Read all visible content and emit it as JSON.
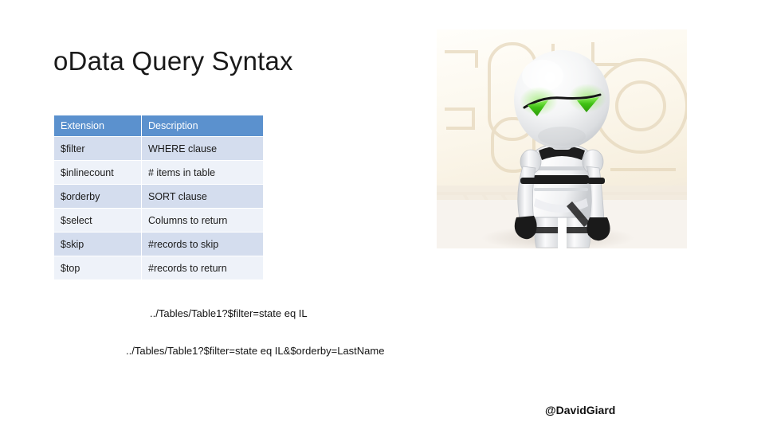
{
  "slide": {
    "title": "oData Query Syntax",
    "footer_handle": "@DavidGiard"
  },
  "table": {
    "name": "odata-query-syntax-table",
    "columns": [
      "Extension",
      "Description"
    ],
    "rows": [
      {
        "extension": "$filter",
        "description": "WHERE clause"
      },
      {
        "extension": "$inlinecount",
        "description": "# items in table"
      },
      {
        "extension": "$orderby",
        "description": "SORT clause"
      },
      {
        "extension": "$select",
        "description": "Columns to return"
      },
      {
        "extension": "$skip",
        "description": "#records to skip"
      },
      {
        "extension": "$top",
        "description": "#records to return"
      }
    ],
    "header_background": "#5B91CE",
    "header_text_color": "#FFFFFF",
    "row_tint_background": "#D4DDEE",
    "row_plain_background": "#EEF2F9"
  },
  "examples": [
    "../Tables/Table1?$filter=state eq IL",
    "../Tables/Table1?$filter=state eq IL&$orderby=LastName"
  ],
  "illustration": {
    "name": "marvin-robot-photo",
    "description": "White humanoid robot with large round head and green triangular eyes",
    "eye_color": "#3FC114",
    "body_color": "#FFFFFF",
    "joint_color": "#1C1C1C",
    "background_color": "#FAF4E8"
  }
}
